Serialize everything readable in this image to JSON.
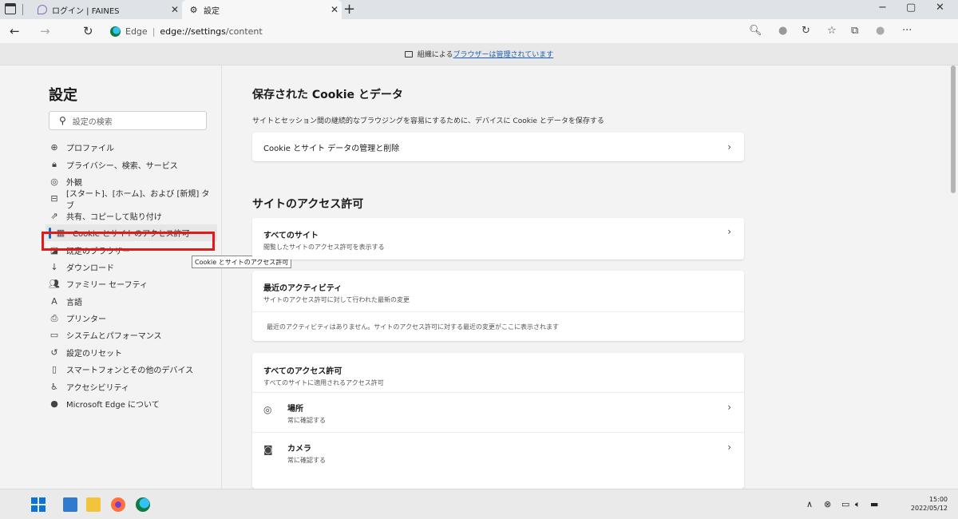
{
  "browser": {
    "tabs": [
      {
        "title": "ログイン | FAINES",
        "icon": "picture-icon"
      },
      {
        "title": "設定",
        "icon": "gear-icon"
      }
    ],
    "new_tab": "+",
    "window_controls": {
      "minimize": "−",
      "restore": "▢",
      "close": "✕"
    },
    "nav": {
      "back": "←",
      "forward": "→",
      "refresh": "↻"
    },
    "address": {
      "app_label": "Edge",
      "separator": "|",
      "host": "edge://settings",
      "path": "/content"
    },
    "toolbar_icons": [
      "read-aloud-icon",
      "extension-icon",
      "refresh-page-icon",
      "favorites-icon",
      "collections-icon",
      "profile-icon",
      "more-icon"
    ],
    "toolbar_glyphs": [
      "🔍︎",
      "●",
      "↻",
      "☆",
      "⧉",
      "●",
      "···"
    ]
  },
  "managed_banner": {
    "prefix": "組織による",
    "link": "ブラウザーは管理されています"
  },
  "sidebar": {
    "title": "設定",
    "search_placeholder": "設定の検索",
    "items": [
      {
        "label": "プロファイル",
        "icon": "profile-icon",
        "glyph": "⊕"
      },
      {
        "label": "プライバシー、検索、サービス",
        "icon": "lock-icon",
        "glyph": "🔒︎"
      },
      {
        "label": "外観",
        "icon": "appearance-icon",
        "glyph": "◎"
      },
      {
        "label": "[スタート]、[ホーム]、および [新規] タブ",
        "icon": "start-home-icon",
        "glyph": "⊟"
      },
      {
        "label": "共有、コピーして貼り付け",
        "icon": "share-icon",
        "glyph": "⇗"
      },
      {
        "label": "Cookie とサイトのアクセス許可",
        "icon": "cookie-permissions-icon",
        "glyph": "▦"
      },
      {
        "label": "既定のブラウザー",
        "icon": "default-browser-icon",
        "glyph": "◪"
      },
      {
        "label": "ダウンロード",
        "icon": "download-icon",
        "glyph": "↓"
      },
      {
        "label": "ファミリー セーフティ",
        "icon": "family-icon",
        "glyph": "👥︎"
      },
      {
        "label": "言語",
        "icon": "language-icon",
        "glyph": "A"
      },
      {
        "label": "プリンター",
        "icon": "printer-icon",
        "glyph": "⎙"
      },
      {
        "label": "システムとパフォーマンス",
        "icon": "system-icon",
        "glyph": "▭"
      },
      {
        "label": "設定のリセット",
        "icon": "reset-icon",
        "glyph": "↺"
      },
      {
        "label": "スマートフォンとその他のデバイス",
        "icon": "phone-icon",
        "glyph": "▯"
      },
      {
        "label": "アクセシビリティ",
        "icon": "accessibility-icon",
        "glyph": "♿︎"
      },
      {
        "label": "Microsoft Edge について",
        "icon": "edge-icon",
        "glyph": "●"
      }
    ],
    "active_index": 5,
    "tooltip": "Cookie とサイトのアクセス許可"
  },
  "content": {
    "cookies": {
      "title": "保存された Cookie とデータ",
      "desc": "サイトとセッション間の継続的なブラウジングを容易にするために、デバイスに Cookie とデータを保存する",
      "row_label": "Cookie とサイト データの管理と削除"
    },
    "permissions": {
      "title": "サイトのアクセス許可",
      "all_sites": {
        "label": "すべてのサイト",
        "sub": "閲覧したサイトのアクセス許可を表示する"
      },
      "recent": {
        "label": "最近のアクティビティ",
        "sub": "サイトのアクセス許可に対して行われた最新の変更",
        "empty": "最近のアクティビティはありません。サイトのアクセス許可に対する最近の変更がここに表示されます"
      },
      "all_permissions": {
        "label": "すべてのアクセス許可",
        "sub": "すべてのサイトに適用されるアクセス許可",
        "items": [
          {
            "label": "場所",
            "sub": "常に確認する",
            "icon": "location-icon",
            "glyph": "◎"
          },
          {
            "label": "カメラ",
            "sub": "常に確認する",
            "icon": "camera-icon",
            "glyph": "◙"
          }
        ]
      }
    },
    "chevron": "›"
  },
  "taskbar": {
    "apps": [
      "start-icon",
      "mail-icon",
      "file-explorer-icon",
      "firefox-icon",
      "edge-icon"
    ],
    "tray": {
      "chevron": "∧",
      "glyphs": [
        "⊗",
        "▭",
        "🔈︎",
        "▬"
      ]
    },
    "time": "15:00",
    "date": "2022/05/12"
  }
}
